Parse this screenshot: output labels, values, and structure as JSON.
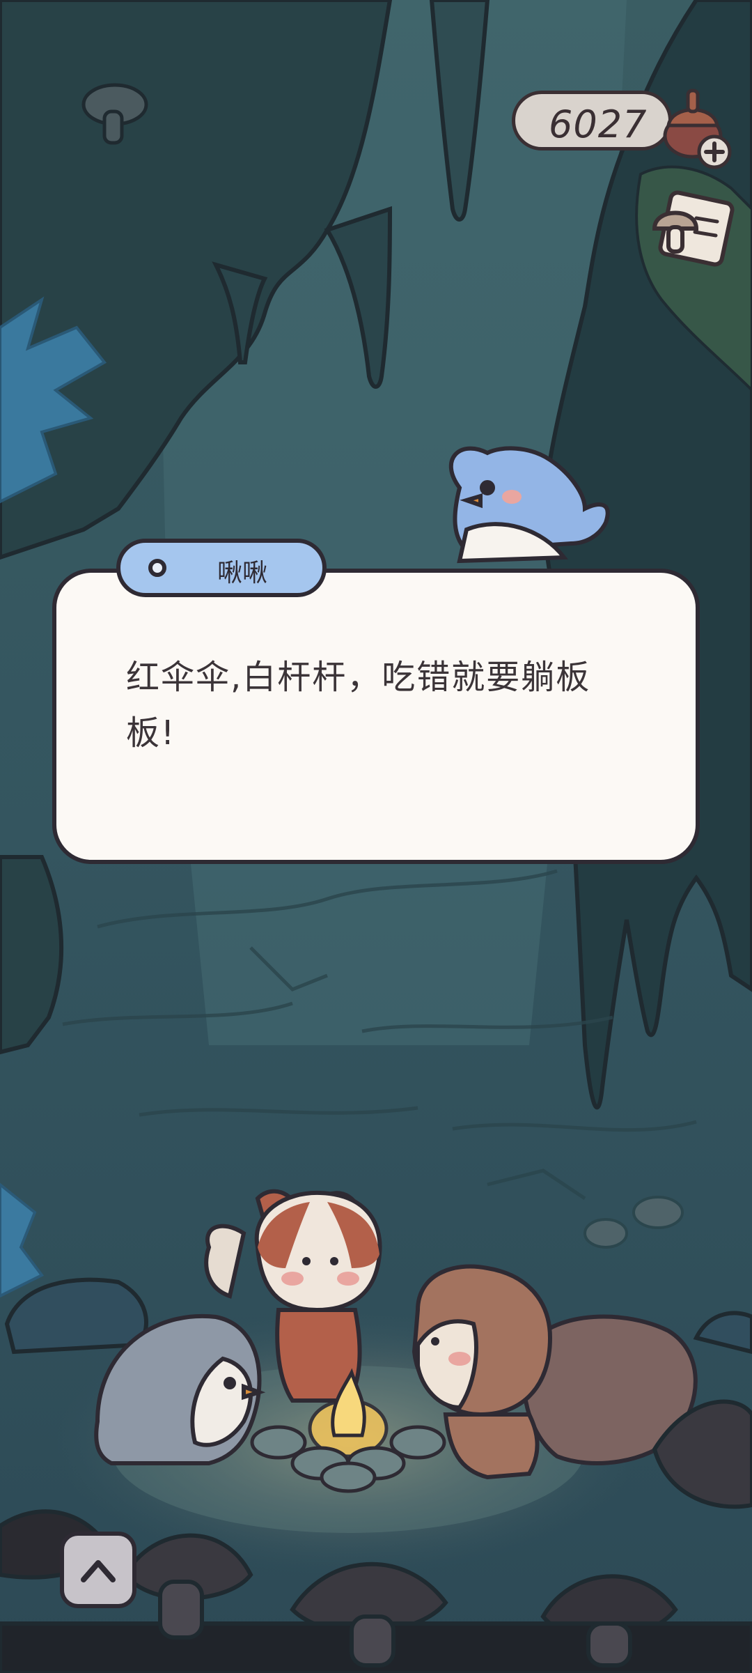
{
  "currency": {
    "amount": "6027",
    "icon": "acorn-icon",
    "add_icon": "plus-icon"
  },
  "journal": {
    "icon": "mushroom-note-icon"
  },
  "dialog": {
    "speaker": "啾啾",
    "text": "红伞伞,白杆杆，吃错就要躺板板!"
  },
  "controls": {
    "expand_icon": "chevron-up-icon"
  },
  "colors": {
    "background": "#2c4a52",
    "dialog_bg": "#fcf9f5",
    "speaker_tab": "#a5c6ee",
    "outline": "#2e2a33"
  }
}
